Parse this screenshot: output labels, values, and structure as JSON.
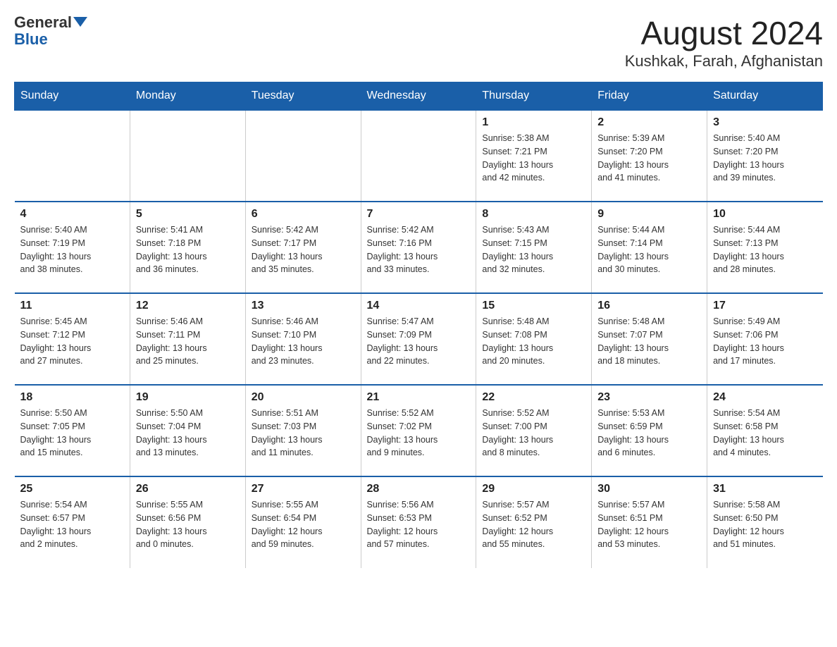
{
  "logo": {
    "line1": "General",
    "line2": "Blue"
  },
  "title": "August 2024",
  "subtitle": "Kushkak, Farah, Afghanistan",
  "days_of_week": [
    "Sunday",
    "Monday",
    "Tuesday",
    "Wednesday",
    "Thursday",
    "Friday",
    "Saturday"
  ],
  "weeks": [
    [
      {
        "day": "",
        "info": ""
      },
      {
        "day": "",
        "info": ""
      },
      {
        "day": "",
        "info": ""
      },
      {
        "day": "",
        "info": ""
      },
      {
        "day": "1",
        "info": "Sunrise: 5:38 AM\nSunset: 7:21 PM\nDaylight: 13 hours\nand 42 minutes."
      },
      {
        "day": "2",
        "info": "Sunrise: 5:39 AM\nSunset: 7:20 PM\nDaylight: 13 hours\nand 41 minutes."
      },
      {
        "day": "3",
        "info": "Sunrise: 5:40 AM\nSunset: 7:20 PM\nDaylight: 13 hours\nand 39 minutes."
      }
    ],
    [
      {
        "day": "4",
        "info": "Sunrise: 5:40 AM\nSunset: 7:19 PM\nDaylight: 13 hours\nand 38 minutes."
      },
      {
        "day": "5",
        "info": "Sunrise: 5:41 AM\nSunset: 7:18 PM\nDaylight: 13 hours\nand 36 minutes."
      },
      {
        "day": "6",
        "info": "Sunrise: 5:42 AM\nSunset: 7:17 PM\nDaylight: 13 hours\nand 35 minutes."
      },
      {
        "day": "7",
        "info": "Sunrise: 5:42 AM\nSunset: 7:16 PM\nDaylight: 13 hours\nand 33 minutes."
      },
      {
        "day": "8",
        "info": "Sunrise: 5:43 AM\nSunset: 7:15 PM\nDaylight: 13 hours\nand 32 minutes."
      },
      {
        "day": "9",
        "info": "Sunrise: 5:44 AM\nSunset: 7:14 PM\nDaylight: 13 hours\nand 30 minutes."
      },
      {
        "day": "10",
        "info": "Sunrise: 5:44 AM\nSunset: 7:13 PM\nDaylight: 13 hours\nand 28 minutes."
      }
    ],
    [
      {
        "day": "11",
        "info": "Sunrise: 5:45 AM\nSunset: 7:12 PM\nDaylight: 13 hours\nand 27 minutes."
      },
      {
        "day": "12",
        "info": "Sunrise: 5:46 AM\nSunset: 7:11 PM\nDaylight: 13 hours\nand 25 minutes."
      },
      {
        "day": "13",
        "info": "Sunrise: 5:46 AM\nSunset: 7:10 PM\nDaylight: 13 hours\nand 23 minutes."
      },
      {
        "day": "14",
        "info": "Sunrise: 5:47 AM\nSunset: 7:09 PM\nDaylight: 13 hours\nand 22 minutes."
      },
      {
        "day": "15",
        "info": "Sunrise: 5:48 AM\nSunset: 7:08 PM\nDaylight: 13 hours\nand 20 minutes."
      },
      {
        "day": "16",
        "info": "Sunrise: 5:48 AM\nSunset: 7:07 PM\nDaylight: 13 hours\nand 18 minutes."
      },
      {
        "day": "17",
        "info": "Sunrise: 5:49 AM\nSunset: 7:06 PM\nDaylight: 13 hours\nand 17 minutes."
      }
    ],
    [
      {
        "day": "18",
        "info": "Sunrise: 5:50 AM\nSunset: 7:05 PM\nDaylight: 13 hours\nand 15 minutes."
      },
      {
        "day": "19",
        "info": "Sunrise: 5:50 AM\nSunset: 7:04 PM\nDaylight: 13 hours\nand 13 minutes."
      },
      {
        "day": "20",
        "info": "Sunrise: 5:51 AM\nSunset: 7:03 PM\nDaylight: 13 hours\nand 11 minutes."
      },
      {
        "day": "21",
        "info": "Sunrise: 5:52 AM\nSunset: 7:02 PM\nDaylight: 13 hours\nand 9 minutes."
      },
      {
        "day": "22",
        "info": "Sunrise: 5:52 AM\nSunset: 7:00 PM\nDaylight: 13 hours\nand 8 minutes."
      },
      {
        "day": "23",
        "info": "Sunrise: 5:53 AM\nSunset: 6:59 PM\nDaylight: 13 hours\nand 6 minutes."
      },
      {
        "day": "24",
        "info": "Sunrise: 5:54 AM\nSunset: 6:58 PM\nDaylight: 13 hours\nand 4 minutes."
      }
    ],
    [
      {
        "day": "25",
        "info": "Sunrise: 5:54 AM\nSunset: 6:57 PM\nDaylight: 13 hours\nand 2 minutes."
      },
      {
        "day": "26",
        "info": "Sunrise: 5:55 AM\nSunset: 6:56 PM\nDaylight: 13 hours\nand 0 minutes."
      },
      {
        "day": "27",
        "info": "Sunrise: 5:55 AM\nSunset: 6:54 PM\nDaylight: 12 hours\nand 59 minutes."
      },
      {
        "day": "28",
        "info": "Sunrise: 5:56 AM\nSunset: 6:53 PM\nDaylight: 12 hours\nand 57 minutes."
      },
      {
        "day": "29",
        "info": "Sunrise: 5:57 AM\nSunset: 6:52 PM\nDaylight: 12 hours\nand 55 minutes."
      },
      {
        "day": "30",
        "info": "Sunrise: 5:57 AM\nSunset: 6:51 PM\nDaylight: 12 hours\nand 53 minutes."
      },
      {
        "day": "31",
        "info": "Sunrise: 5:58 AM\nSunset: 6:50 PM\nDaylight: 12 hours\nand 51 minutes."
      }
    ]
  ]
}
